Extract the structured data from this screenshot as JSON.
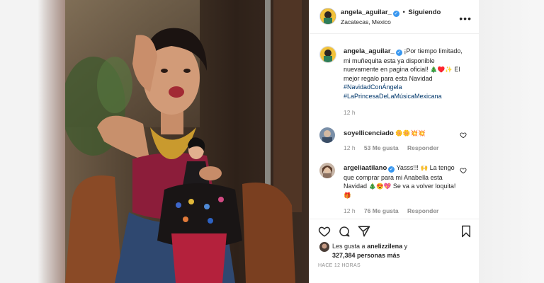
{
  "header": {
    "username": "angela_aguilar_",
    "separator": "•",
    "follow_label": "Siguiendo",
    "location": "Zacatecas, Mexico",
    "more_icon": "more-dots-icon"
  },
  "caption": {
    "username": "angela_aguilar_",
    "text": "¡Por tiempo limitado, mi muñequita esta ya disponible nuevamente en pagina oficial!",
    "emojis": "🎄♥️✨",
    "text2": "El mejor regalo para esta Navidad",
    "hashtag1": "#NavidadConÁngela",
    "hashtag2": "#LaPrincesaDeLaMúsicaMexicana",
    "time": "12 h"
  },
  "comments": [
    {
      "username": "soyellicenciado",
      "emojis": "🌼🌼💥💥",
      "time": "12 h",
      "likes": "53 Me gusta",
      "reply": "Responder"
    },
    {
      "username": "argeliaatilano",
      "text1": "Yasss!!!",
      "emoji1": "🙌",
      "text2": "La tengo que comprar para mi Anabella esta Navidad",
      "emoji2": "🎄😍💖",
      "text3": "Se va a volver loquita!",
      "emoji3": "🎁",
      "time": "12 h",
      "likes": "76 Me gusta",
      "reply": "Responder"
    }
  ],
  "actions": {
    "like_icon": "heart-icon",
    "comment_icon": "comment-icon",
    "share_icon": "share-icon",
    "save_icon": "bookmark-icon"
  },
  "likes": {
    "prefix": "Les gusta a",
    "user": "anelizzilena",
    "conj": "y",
    "count": "327,384 personas más"
  },
  "timestamp": "HACE 12 HORAS",
  "colors": {
    "verified": "#3897f0",
    "hashtag": "#00376b",
    "muted": "#8e8e8e"
  }
}
